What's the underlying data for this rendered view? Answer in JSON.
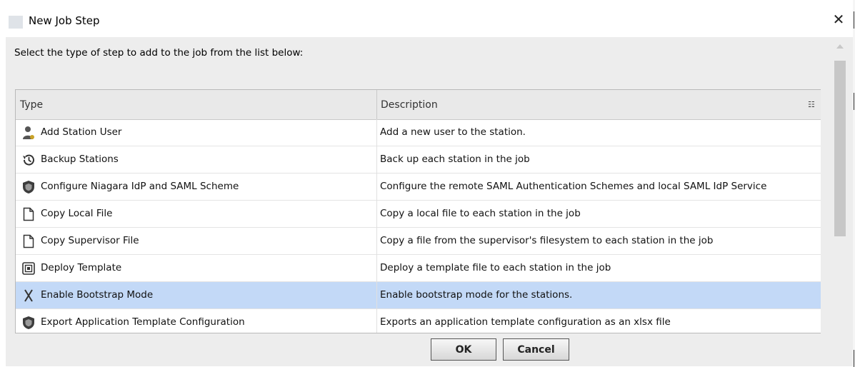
{
  "window": {
    "title": "New Job Step"
  },
  "instructions": "Select the type of step to add to the job from the list below:",
  "table": {
    "columns": {
      "type": "Type",
      "description": "Description"
    },
    "selected_index": 6,
    "rows": [
      {
        "type": "Add Station User",
        "description": "Add a new user to the station.",
        "icon": "user-add-icon"
      },
      {
        "type": "Backup Stations",
        "description": "Back up each station in the job",
        "icon": "history-icon"
      },
      {
        "type": "Configure Niagara IdP and SAML Scheme",
        "description": "Configure the remote SAML Authentication Schemes and local SAML IdP Service",
        "icon": "shield-icon"
      },
      {
        "type": "Copy Local File",
        "description": "Copy a local file to each station in the job",
        "icon": "file-icon"
      },
      {
        "type": "Copy Supervisor File",
        "description": "Copy a file from the supervisor's filesystem to each station in the job",
        "icon": "file-icon"
      },
      {
        "type": "Deploy Template",
        "description": "Deploy a template file to each station in the job",
        "icon": "template-icon"
      },
      {
        "type": "Enable Bootstrap Mode",
        "description": "Enable bootstrap mode for the stations.",
        "icon": "bootstrap-icon"
      },
      {
        "type": "Export Application Template Configuration",
        "description": "Exports an application template configuration as an xlsx file",
        "icon": "shield-icon"
      }
    ]
  },
  "buttons": {
    "ok": "OK",
    "cancel": "Cancel"
  },
  "colors": {
    "selection": "#c3d9f7",
    "header": "#e9e9e9",
    "background": "#ededed"
  }
}
